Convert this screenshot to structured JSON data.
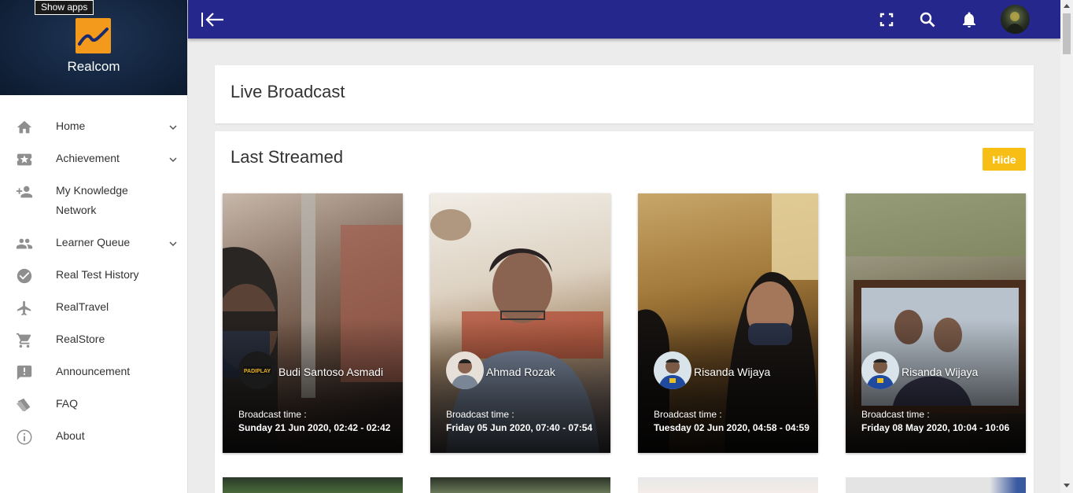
{
  "tooltip": "Show apps",
  "brand": {
    "name": "Realcom"
  },
  "sidebar": {
    "items": [
      {
        "label": "Home",
        "icon": "home-icon",
        "chevron": true
      },
      {
        "label": "Achievement",
        "icon": "ticket-star-icon",
        "chevron": true
      },
      {
        "label": "My Knowledge Network",
        "icon": "people-add-icon",
        "chevron": false
      },
      {
        "label": "Learner Queue",
        "icon": "people-icon",
        "chevron": true
      },
      {
        "label": "Real Test History",
        "icon": "check-circle-icon",
        "chevron": false
      },
      {
        "label": "RealTravel",
        "icon": "airplane-icon",
        "chevron": false
      },
      {
        "label": "RealStore",
        "icon": "cart-icon",
        "chevron": false
      },
      {
        "label": "Announcement",
        "icon": "announcement-icon",
        "chevron": false
      },
      {
        "label": "FAQ",
        "icon": "tags-icon",
        "chevron": false
      },
      {
        "label": "About",
        "icon": "info-icon",
        "chevron": false
      }
    ]
  },
  "topbar": {
    "color": "#26278c",
    "icons": [
      "back-icon",
      "fullscreen-icon",
      "search-icon",
      "bell-icon",
      "avatar"
    ]
  },
  "live": {
    "title": "Live Broadcast"
  },
  "last": {
    "title": "Last Streamed",
    "hide_label": "Hide",
    "broadcast_label": "Broadcast time :",
    "cards": [
      {
        "name": "Budi Santoso Asmadi",
        "time": "Sunday 21 Jun 2020, 02:42 - 02:42"
      },
      {
        "name": "Ahmad Rozak",
        "time": "Friday 05 Jun 2020, 07:40 - 07:54"
      },
      {
        "name": "Risanda Wijaya",
        "time": "Tuesday 02 Jun 2020, 04:58 - 04:59"
      },
      {
        "name": "Risanda Wijaya",
        "time": "Friday 08 May 2020, 10:04 - 10:06"
      }
    ]
  },
  "colors": {
    "accent": "#f7be16",
    "topbar": "#26278c",
    "logo": "#f39a1d"
  }
}
